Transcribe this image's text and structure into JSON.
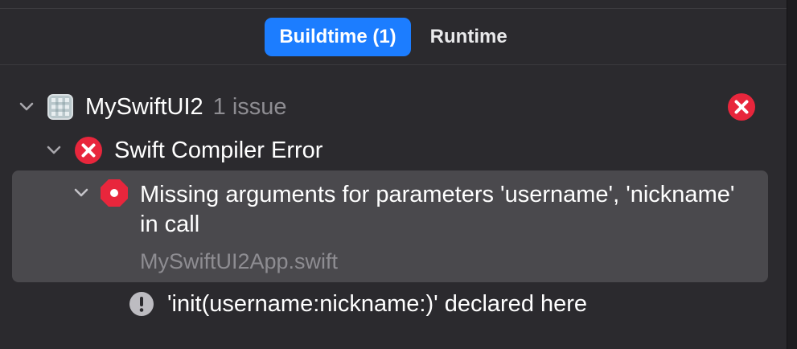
{
  "tabs": [
    {
      "label": "Buildtime (1)",
      "active": true
    },
    {
      "label": "Runtime",
      "active": false
    }
  ],
  "project": {
    "name": "MySwiftUI2",
    "issue_count": "1 issue",
    "icon": "project-icon",
    "status_icon": "error-x-icon"
  },
  "group": {
    "title": "Swift Compiler Error",
    "icon": "error-x-icon"
  },
  "issue": {
    "message": "Missing arguments for parameters 'username', 'nickname' in call",
    "file": "MySwiftUI2App.swift",
    "icon": "stop-error-icon"
  },
  "note": {
    "message": "'init(username:nickname:)' declared here",
    "icon": "exclamation-icon"
  },
  "colors": {
    "accent": "#1c7dff",
    "error": "#e8263c",
    "background": "#2b2a2e",
    "selection": "#4a494d",
    "secondary_text": "#8e8d92"
  }
}
